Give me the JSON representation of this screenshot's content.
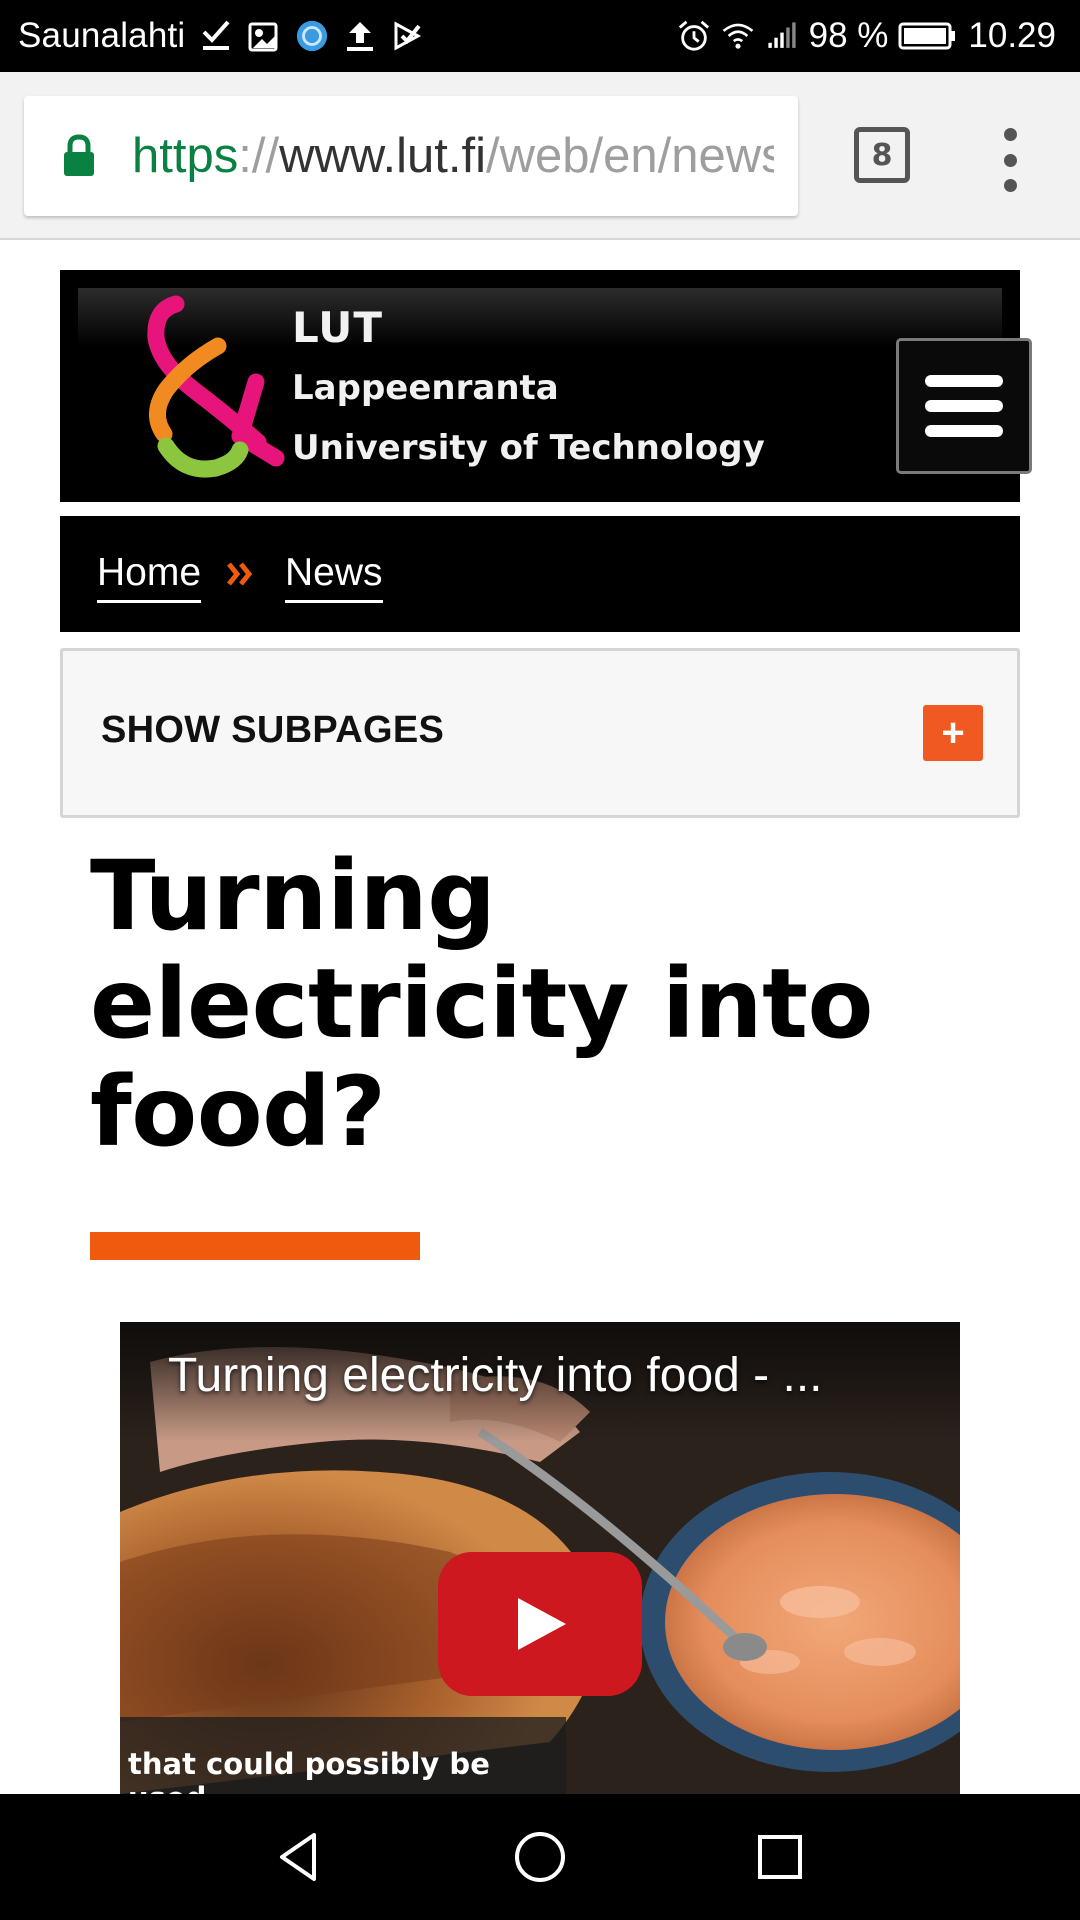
{
  "status_bar": {
    "carrier": "Saunalahti",
    "battery_percent": "98 %",
    "time": "10.29",
    "icons": [
      "check-icon",
      "gallery-icon",
      "blue-circle-icon",
      "upload-icon",
      "tasks-icon",
      "alarm-icon",
      "wifi-icon",
      "signal-icon",
      "battery-icon"
    ]
  },
  "browser": {
    "url_scheme": "https",
    "url_sep": "://",
    "url_host": "www.lut.fi",
    "url_path": "/web/en/news",
    "tab_count": "8",
    "accent_color": "#0b8043"
  },
  "site": {
    "logo_line1": "LUT",
    "logo_line2": "Lappeenranta",
    "logo_line3": "University of Technology"
  },
  "breadcrumb": {
    "home": "Home",
    "current": "News",
    "separator_color": "#f05a0f"
  },
  "subpages": {
    "label": "SHOW SUBPAGES",
    "toggle": "+"
  },
  "article": {
    "title_line1": "Turning",
    "title_line2": "electricity into",
    "title_line3": "food?",
    "accent_color": "#f05a0f"
  },
  "video": {
    "title": "Turning electricity into food - ...",
    "caption": "that could possibly be used"
  }
}
